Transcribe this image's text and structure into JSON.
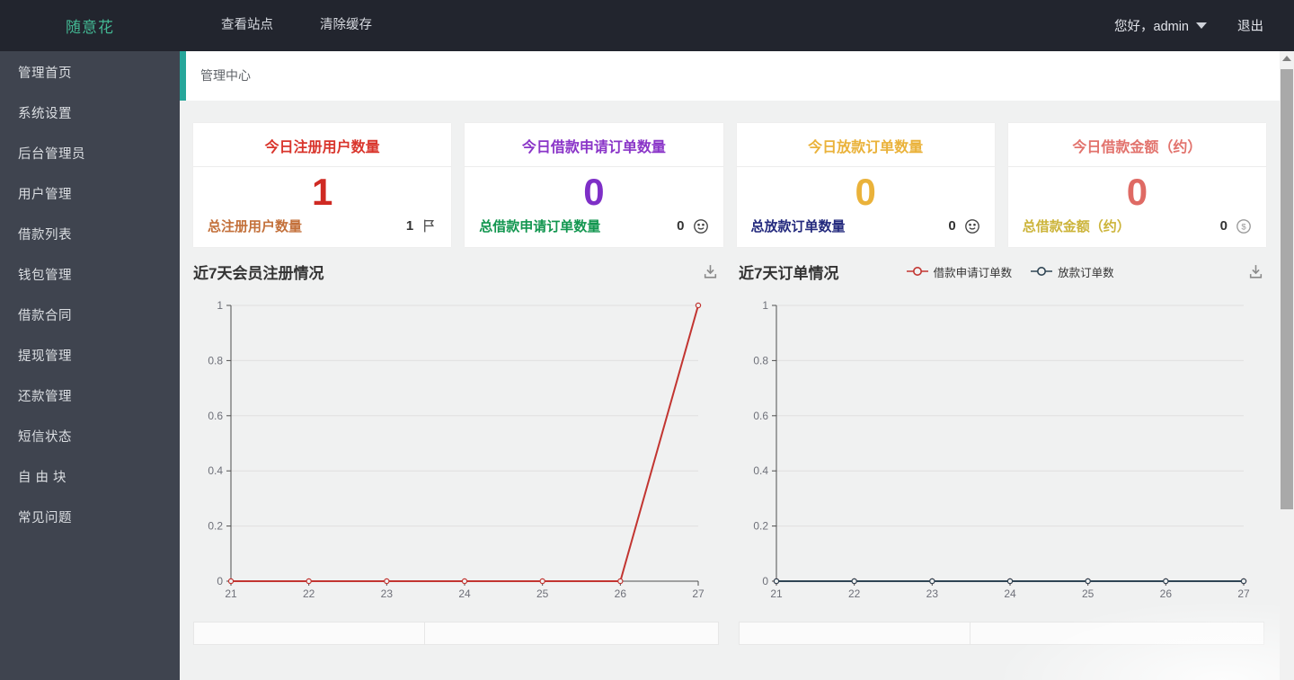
{
  "topbar": {
    "brand": "随意花",
    "nav": [
      {
        "label": "查看站点"
      },
      {
        "label": "清除缓存"
      }
    ],
    "greeting": "您好，admin",
    "logout_label": "退出"
  },
  "sidebar": {
    "items": [
      {
        "label": "管理首页"
      },
      {
        "label": "系统设置"
      },
      {
        "label": "后台管理员"
      },
      {
        "label": "用户管理"
      },
      {
        "label": "借款列表"
      },
      {
        "label": "钱包管理"
      },
      {
        "label": "借款合同"
      },
      {
        "label": "提现管理"
      },
      {
        "label": "还款管理"
      },
      {
        "label": "短信状态"
      },
      {
        "label": "自 由 块"
      },
      {
        "label": "常见问题"
      }
    ]
  },
  "breadcrumb": {
    "title": "管理中心"
  },
  "stat_cards": [
    {
      "title": "今日注册用户数量",
      "value": "1",
      "footer_label": "总注册用户数量",
      "footer_value": "1",
      "icon": "flag-icon",
      "title_color": "#d9352c",
      "value_color": "#cf2a23",
      "footer_label_color": "#c3703a"
    },
    {
      "title": "今日借款申请订单数量",
      "value": "0",
      "footer_label": "总借款申请订单数量",
      "footer_value": "0",
      "icon": "smiley-icon",
      "title_color": "#8a35c8",
      "value_color": "#7e2fc7",
      "footer_label_color": "#12964f"
    },
    {
      "title": "今日放款订单数量",
      "value": "0",
      "footer_label": "总放款订单数量",
      "footer_value": "0",
      "icon": "smiley-icon",
      "title_color": "#eab23a",
      "value_color": "#eab23a",
      "footer_label_color": "#23297d"
    },
    {
      "title": "今日借款金额（约）",
      "value": "0",
      "footer_label": "总借款金额（约）",
      "footer_value": "0",
      "icon": "dollar-circle-icon",
      "title_color": "#e2736d",
      "value_color": "#df6a64",
      "footer_label_color": "#ccb43a"
    }
  ],
  "chart_data": [
    {
      "type": "line",
      "title": "近7天会员注册情况",
      "x": [
        21,
        22,
        23,
        24,
        25,
        26,
        27
      ],
      "series": [
        {
          "name": "",
          "values": [
            0,
            0,
            0,
            0,
            0,
            0,
            1
          ],
          "color": "#c23531"
        }
      ],
      "ylim": [
        0,
        1
      ],
      "yticks": [
        0,
        0.2,
        0.4,
        0.6,
        0.8,
        1
      ],
      "grid": true,
      "legend": false
    },
    {
      "type": "line",
      "title": "近7天订单情况",
      "x": [
        21,
        22,
        23,
        24,
        25,
        26,
        27
      ],
      "series": [
        {
          "name": "借款申请订单数",
          "values": [
            0,
            0,
            0,
            0,
            0,
            0,
            0
          ],
          "color": "#c23531"
        },
        {
          "name": "放款订单数",
          "values": [
            0,
            0,
            0,
            0,
            0,
            0,
            0
          ],
          "color": "#2f4554"
        }
      ],
      "ylim": [
        0,
        1
      ],
      "yticks": [
        0,
        0.2,
        0.4,
        0.6,
        0.8,
        1
      ],
      "grid": true,
      "legend": "top"
    }
  ],
  "colors": {
    "accent_teal": "#26a69a",
    "topbar_bg": "#22252e",
    "sidebar_bg": "#3f444f",
    "page_bg": "#f0f1f1",
    "card_bg": "#ffffff",
    "series_red": "#c23531",
    "series_dark": "#2f4554",
    "axis_text": "#6e7079",
    "grid_line": "#e0e0e0"
  }
}
